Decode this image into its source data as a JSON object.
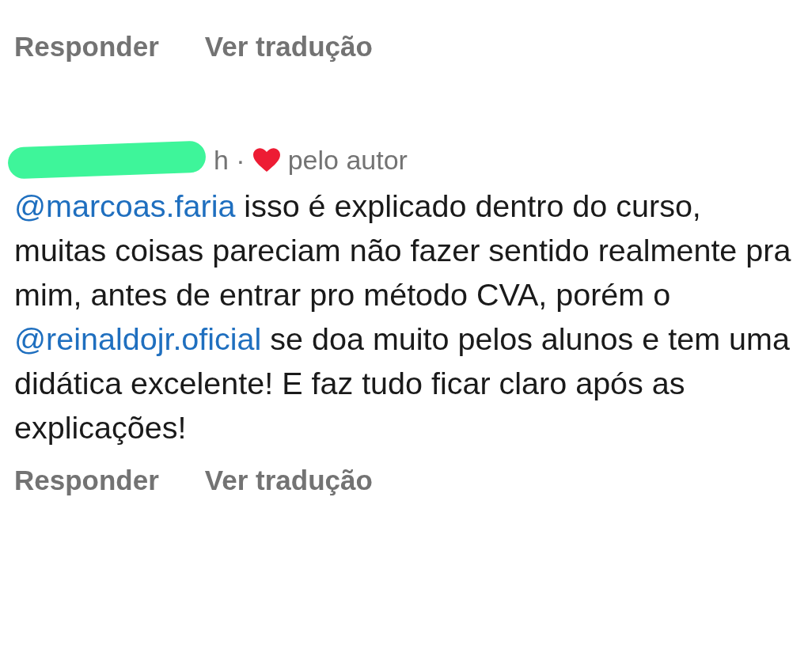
{
  "top_actions": [
    {
      "label": "Responder"
    },
    {
      "label": "Ver tradução"
    }
  ],
  "comment": {
    "time": "h ·",
    "liked_by_author": true,
    "liked_label": "pelo autor",
    "body": [
      {
        "kind": "mention",
        "text": "@marcoas.faria"
      },
      {
        "kind": "text",
        "text": " isso é explicado dentro do curso, muitas coisas pareciam não fazer sentido realmente pra mim, antes de entrar pro método CVA, porém o "
      },
      {
        "kind": "mention",
        "text": "@reinaldojr.oficial"
      },
      {
        "kind": "text",
        "text": " se doa muito pelos alunos e tem uma didática excelente! E faz tudo ficar claro após as explicações!"
      }
    ],
    "actions": [
      {
        "label": "Responder"
      },
      {
        "label": "Ver tradução"
      }
    ]
  }
}
